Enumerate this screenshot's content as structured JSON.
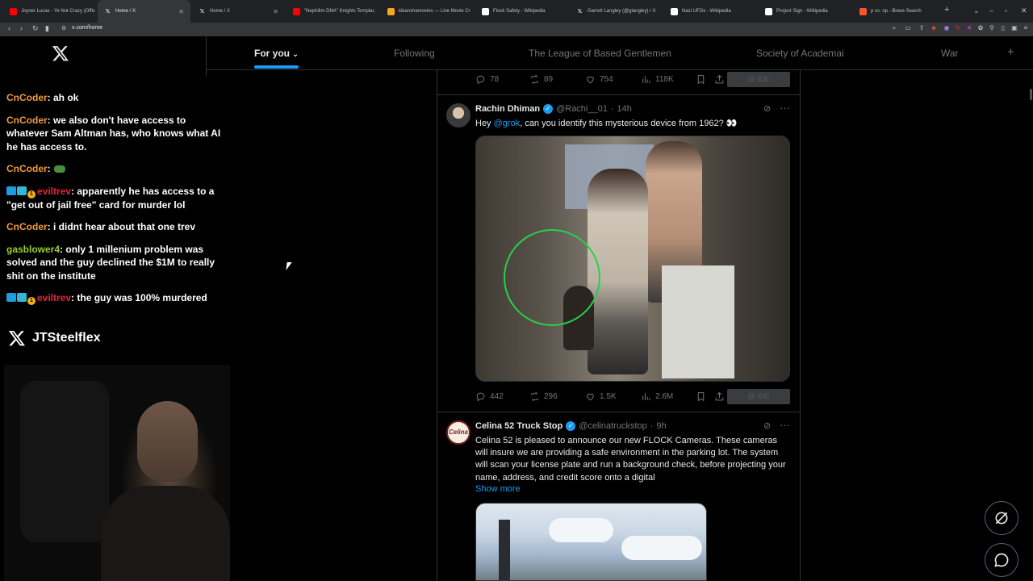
{
  "browser": {
    "tabs": [
      {
        "title": "Joyner Lucas - Ye Not Crazy (Offic",
        "favicon": "youtube-icon",
        "color": "#ff0000",
        "active": false
      },
      {
        "title": "Home / X",
        "favicon": "x-icon",
        "color": "#000000",
        "active": true
      },
      {
        "title": "Home / X",
        "favicon": "x-icon",
        "color": "#000000",
        "active": false
      },
      {
        "title": "\"Nephilim DNA\" Knights Templar,",
        "favicon": "youtube-icon",
        "color": "#ff0000",
        "active": false
      },
      {
        "title": "kikanshamovies — Live Movie Cr",
        "favicon": "kick-icon",
        "color": "#f5a623",
        "active": false
      },
      {
        "title": "Flock Safety - Wikipedia",
        "favicon": "wikipedia-icon",
        "color": "#ffffff",
        "active": false
      },
      {
        "title": "Garrett Langley (@glangley) / X",
        "favicon": "x-icon",
        "color": "#000000",
        "active": false
      },
      {
        "title": "Nazi UFOs - Wikipedia",
        "favicon": "wikipedia-icon",
        "color": "#ffffff",
        "active": false
      },
      {
        "title": "Project Sign - Wikipedia",
        "favicon": "wikipedia-icon",
        "color": "#ffffff",
        "active": false
      },
      {
        "title": "p vs. np - Brave Search",
        "favicon": "brave-icon",
        "color": "#fb542b",
        "active": false
      }
    ],
    "new_tab_label": "+",
    "url": "x.com/home"
  },
  "top_tabs": [
    {
      "label": "For you",
      "active": true
    },
    {
      "label": "Following",
      "active": false
    },
    {
      "label": "The League of Based Gentlemen",
      "active": false
    },
    {
      "label": "Society of Academai",
      "active": false
    },
    {
      "label": "War",
      "active": false
    }
  ],
  "top_tabs_add": "+",
  "chat": [
    {
      "user": "CnCoder",
      "user_color": "#f29a3d",
      "badges": false,
      "text": ": ah ok"
    },
    {
      "user": "CnCoder",
      "user_color": "#f29a3d",
      "badges": false,
      "text": ": we also don't have access to whatever Sam Altman has, who knows what AI he has access to."
    },
    {
      "user": "CnCoder",
      "user_color": "#f29a3d",
      "badges": false,
      "text": ":",
      "emote": true
    },
    {
      "user": "eviltrev",
      "user_color": "#e0283a",
      "badges": true,
      "badge_num": "1",
      "text": ": apparently he has access to a \"get out of jail free\" card for murder lol"
    },
    {
      "user": "CnCoder",
      "user_color": "#f29a3d",
      "badges": false,
      "text": ": i didnt hear about that one trev"
    },
    {
      "user": "gasblower4",
      "user_color": "#9acd32",
      "badges": false,
      "text": ": only 1 millenium problem was solved and the guy declined the $1M to really shit on the institute"
    },
    {
      "user": "eviltrev",
      "user_color": "#e0283a",
      "badges": true,
      "badge_num": "1",
      "text": ": the guy was 100% murdered"
    }
  ],
  "streamer_name": "JTSteelflex",
  "tweet0_actions": {
    "replies": "78",
    "reposts": "89",
    "likes": "754",
    "views": "118K",
    "grok": "@ IDE"
  },
  "tweet1": {
    "name": "Rachin Dhiman",
    "handle": "@Rachi__01",
    "time": "14h",
    "text_before": "Hey ",
    "mention": "@grok",
    "text_after": ", can you identify this mysterious device from 1962? 👀",
    "actions": {
      "replies": "442",
      "reposts": "296",
      "likes": "1.5K",
      "views": "2.6M",
      "grok": "@ IDE"
    }
  },
  "tweet2": {
    "name": "Celina 52 Truck Stop",
    "handle": "@celinatruckstop",
    "time": "9h",
    "avatar_text": "Celina",
    "text": "Celina 52 is pleased to announce our new FLOCK Cameras. These cameras will insure we are providing a safe environment in the parking lot. The system will scan your license plate and run a background check, before projecting your name, address, and credit score onto a digital",
    "show_more": "Show more"
  },
  "colors": {
    "accent": "#1d9bf0",
    "bg": "#000000",
    "muted": "#71767b",
    "border": "#2f3336"
  }
}
